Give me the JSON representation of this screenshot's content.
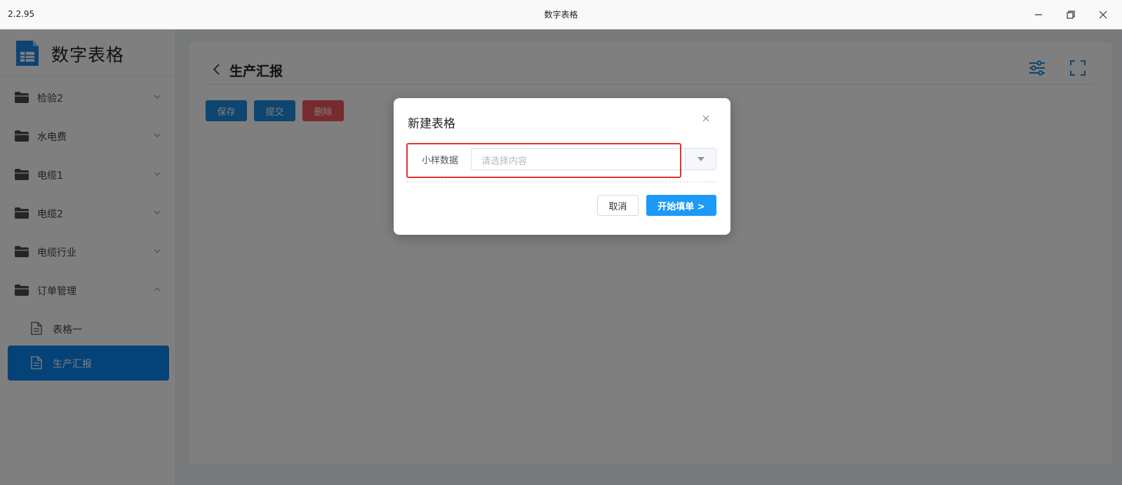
{
  "window": {
    "version": "2.2.95",
    "title": "数字表格"
  },
  "sidebar": {
    "brand": "数字表格",
    "items": [
      {
        "label": "检验2",
        "expanded": false
      },
      {
        "label": "水电费",
        "expanded": false
      },
      {
        "label": "电缆1",
        "expanded": false
      },
      {
        "label": "电缆2",
        "expanded": false
      },
      {
        "label": "电缆行业",
        "expanded": false
      },
      {
        "label": "订单管理",
        "expanded": true
      }
    ],
    "subitems": [
      {
        "label": "表格一",
        "active": false
      },
      {
        "label": "生产汇报",
        "active": true
      }
    ]
  },
  "main": {
    "title": "生产汇报",
    "buttons": {
      "save": "保存",
      "submit": "提交",
      "delete": "删除"
    }
  },
  "modal": {
    "title": "新建表格",
    "field_label": "小样数据",
    "select_placeholder": "请选择内容",
    "cancel": "取消",
    "start": "开始填单 >"
  },
  "colors": {
    "primary": "#1a8cdf",
    "danger": "#f0575a",
    "active_nav": "#0a84f0",
    "highlight_border": "#e8302e"
  }
}
